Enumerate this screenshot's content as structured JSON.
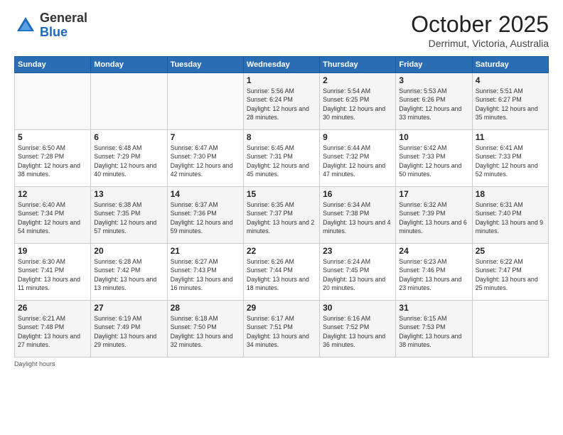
{
  "header": {
    "logo_general": "General",
    "logo_blue": "Blue",
    "month_title": "October 2025",
    "subtitle": "Derrimut, Victoria, Australia"
  },
  "days_of_week": [
    "Sunday",
    "Monday",
    "Tuesday",
    "Wednesday",
    "Thursday",
    "Friday",
    "Saturday"
  ],
  "footer": {
    "note": "Daylight hours"
  },
  "weeks": [
    [
      {
        "day": "",
        "info": ""
      },
      {
        "day": "",
        "info": ""
      },
      {
        "day": "",
        "info": ""
      },
      {
        "day": "1",
        "info": "Sunrise: 5:56 AM\nSunset: 6:24 PM\nDaylight: 12 hours\nand 28 minutes."
      },
      {
        "day": "2",
        "info": "Sunrise: 5:54 AM\nSunset: 6:25 PM\nDaylight: 12 hours\nand 30 minutes."
      },
      {
        "day": "3",
        "info": "Sunrise: 5:53 AM\nSunset: 6:26 PM\nDaylight: 12 hours\nand 33 minutes."
      },
      {
        "day": "4",
        "info": "Sunrise: 5:51 AM\nSunset: 6:27 PM\nDaylight: 12 hours\nand 35 minutes."
      }
    ],
    [
      {
        "day": "5",
        "info": "Sunrise: 6:50 AM\nSunset: 7:28 PM\nDaylight: 12 hours\nand 38 minutes."
      },
      {
        "day": "6",
        "info": "Sunrise: 6:48 AM\nSunset: 7:29 PM\nDaylight: 12 hours\nand 40 minutes."
      },
      {
        "day": "7",
        "info": "Sunrise: 6:47 AM\nSunset: 7:30 PM\nDaylight: 12 hours\nand 42 minutes."
      },
      {
        "day": "8",
        "info": "Sunrise: 6:45 AM\nSunset: 7:31 PM\nDaylight: 12 hours\nand 45 minutes."
      },
      {
        "day": "9",
        "info": "Sunrise: 6:44 AM\nSunset: 7:32 PM\nDaylight: 12 hours\nand 47 minutes."
      },
      {
        "day": "10",
        "info": "Sunrise: 6:42 AM\nSunset: 7:33 PM\nDaylight: 12 hours\nand 50 minutes."
      },
      {
        "day": "11",
        "info": "Sunrise: 6:41 AM\nSunset: 7:33 PM\nDaylight: 12 hours\nand 52 minutes."
      }
    ],
    [
      {
        "day": "12",
        "info": "Sunrise: 6:40 AM\nSunset: 7:34 PM\nDaylight: 12 hours\nand 54 minutes."
      },
      {
        "day": "13",
        "info": "Sunrise: 6:38 AM\nSunset: 7:35 PM\nDaylight: 12 hours\nand 57 minutes."
      },
      {
        "day": "14",
        "info": "Sunrise: 6:37 AM\nSunset: 7:36 PM\nDaylight: 12 hours\nand 59 minutes."
      },
      {
        "day": "15",
        "info": "Sunrise: 6:35 AM\nSunset: 7:37 PM\nDaylight: 13 hours\nand 2 minutes."
      },
      {
        "day": "16",
        "info": "Sunrise: 6:34 AM\nSunset: 7:38 PM\nDaylight: 13 hours\nand 4 minutes."
      },
      {
        "day": "17",
        "info": "Sunrise: 6:32 AM\nSunset: 7:39 PM\nDaylight: 13 hours\nand 6 minutes."
      },
      {
        "day": "18",
        "info": "Sunrise: 6:31 AM\nSunset: 7:40 PM\nDaylight: 13 hours\nand 9 minutes."
      }
    ],
    [
      {
        "day": "19",
        "info": "Sunrise: 6:30 AM\nSunset: 7:41 PM\nDaylight: 13 hours\nand 11 minutes."
      },
      {
        "day": "20",
        "info": "Sunrise: 6:28 AM\nSunset: 7:42 PM\nDaylight: 13 hours\nand 13 minutes."
      },
      {
        "day": "21",
        "info": "Sunrise: 6:27 AM\nSunset: 7:43 PM\nDaylight: 13 hours\nand 16 minutes."
      },
      {
        "day": "22",
        "info": "Sunrise: 6:26 AM\nSunset: 7:44 PM\nDaylight: 13 hours\nand 18 minutes."
      },
      {
        "day": "23",
        "info": "Sunrise: 6:24 AM\nSunset: 7:45 PM\nDaylight: 13 hours\nand 20 minutes."
      },
      {
        "day": "24",
        "info": "Sunrise: 6:23 AM\nSunset: 7:46 PM\nDaylight: 13 hours\nand 23 minutes."
      },
      {
        "day": "25",
        "info": "Sunrise: 6:22 AM\nSunset: 7:47 PM\nDaylight: 13 hours\nand 25 minutes."
      }
    ],
    [
      {
        "day": "26",
        "info": "Sunrise: 6:21 AM\nSunset: 7:48 PM\nDaylight: 13 hours\nand 27 minutes."
      },
      {
        "day": "27",
        "info": "Sunrise: 6:19 AM\nSunset: 7:49 PM\nDaylight: 13 hours\nand 29 minutes."
      },
      {
        "day": "28",
        "info": "Sunrise: 6:18 AM\nSunset: 7:50 PM\nDaylight: 13 hours\nand 32 minutes."
      },
      {
        "day": "29",
        "info": "Sunrise: 6:17 AM\nSunset: 7:51 PM\nDaylight: 13 hours\nand 34 minutes."
      },
      {
        "day": "30",
        "info": "Sunrise: 6:16 AM\nSunset: 7:52 PM\nDaylight: 13 hours\nand 36 minutes."
      },
      {
        "day": "31",
        "info": "Sunrise: 6:15 AM\nSunset: 7:53 PM\nDaylight: 13 hours\nand 38 minutes."
      },
      {
        "day": "",
        "info": ""
      }
    ]
  ]
}
